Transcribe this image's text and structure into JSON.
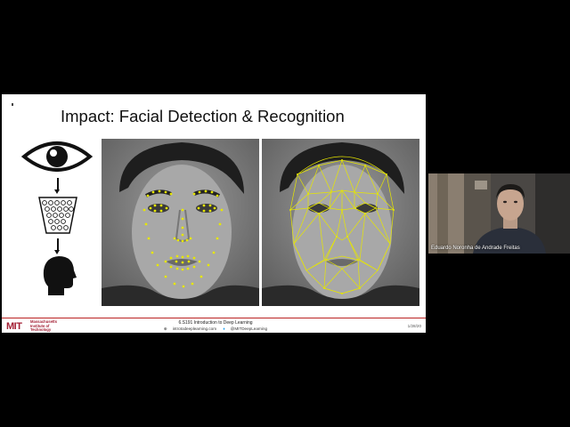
{
  "slide": {
    "title": "Impact: Facial Detection & Recognition",
    "footer": {
      "logo_text": "MIT",
      "institution": "Massachusetts Institute of Technology",
      "course_title": "6.S191 Introduction to Deep Learning",
      "website": "introtodeeplearning.com",
      "twitter": "@MITDeepLearning",
      "date": "1/28/20"
    }
  },
  "webcam": {
    "participant_name": "Eduardo Noronha de Andrade Freitas"
  },
  "icons": [
    "eye-icon",
    "neural-network-icon",
    "head-icon",
    "twitter-icon",
    "globe-icon"
  ],
  "colors": {
    "mit_red": "#a31f34",
    "landmark_yellow": "#e6e600",
    "background": "#000000"
  }
}
